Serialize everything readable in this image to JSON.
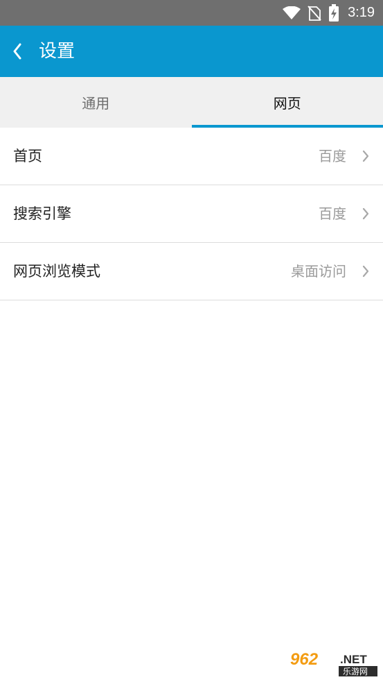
{
  "status_bar": {
    "time": "3:19",
    "icons": [
      "wifi-icon",
      "no-sim-icon",
      "battery-charging-icon"
    ]
  },
  "header": {
    "back_icon": "back-chevron-icon",
    "title": "设置"
  },
  "tabs": [
    {
      "label": "通用",
      "active": false
    },
    {
      "label": "网页",
      "active": true
    }
  ],
  "settings": [
    {
      "label": "首页",
      "value": "百度"
    },
    {
      "label": "搜索引擎",
      "value": "百度"
    },
    {
      "label": "网页浏览模式",
      "value": "桌面访问"
    }
  ],
  "watermark": {
    "number": "962",
    "suffix": ".NET",
    "text": "乐游网"
  },
  "colors": {
    "accent": "#0a97cf",
    "status_bar": "#6f6f6f",
    "tab_bar": "#f0f0f0",
    "divider": "#dcdcdc",
    "value_text": "#9a9a9a"
  }
}
